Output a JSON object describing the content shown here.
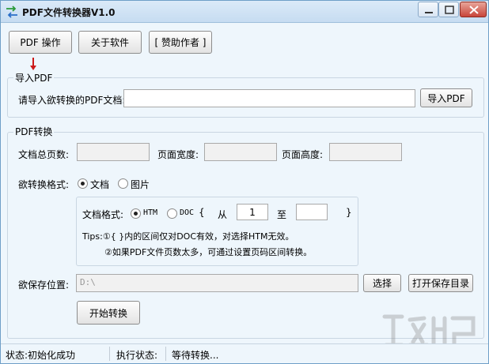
{
  "window": {
    "title": "PDF文件转换器V1.0"
  },
  "toolbar": {
    "pdf_ops": "PDF 操作",
    "about": "关于软件",
    "sponsor": "[ 赞助作者 ]"
  },
  "import_group": {
    "legend": "导入PDF",
    "prompt": "请导入欲转换的PDF文档:",
    "path_value": "",
    "button": "导入PDF"
  },
  "convert_group": {
    "legend": "PDF转换",
    "total_pages_label": "文档总页数:",
    "page_width_label": "页面宽度:",
    "page_height_label": "页面高度:",
    "total_pages_value": "",
    "page_width_value": "",
    "page_height_value": "",
    "format_label": "欲转换格式:",
    "format_options": {
      "document": "文档",
      "image": "图片"
    },
    "format_selected": "文档",
    "doc_format_label": "文档格式:",
    "doc_format_options": {
      "htm": "HTM",
      "doc": "DOC"
    },
    "doc_format_selected": "HTM",
    "range_open": "{",
    "range_from_label": "从",
    "range_from_value": "1",
    "range_to_label": "至",
    "range_to_value": "",
    "range_close": "}",
    "tips_line1": "Tips:①{ }内的区间仅对DOC有效，对选择HTM无效。",
    "tips_line2": "②如果PDF文件页数太多，可通过设置页码区间转换。",
    "save_location_label": "欲保存位置:",
    "save_location_value": "D:\\",
    "select_button": "选择",
    "open_dir_button": "打开保存目录",
    "start_button": "开始转换"
  },
  "statusbar": {
    "status": "状态:初始化成功",
    "exec_label": "执行状态:",
    "exec_value": "等待转换..."
  },
  "colors": {
    "window_bg": "#eef6fc",
    "title_gradient_top": "#dbeaf8",
    "close_button": "#c8453a",
    "arrow": "#cc1a1a"
  },
  "icons": {
    "app": "convert-arrows-icon",
    "minimize": "minimize-icon",
    "maximize": "maximize-icon",
    "close": "close-icon",
    "pointer": "red-down-arrow-icon",
    "watermark": "site-watermark-logo"
  }
}
